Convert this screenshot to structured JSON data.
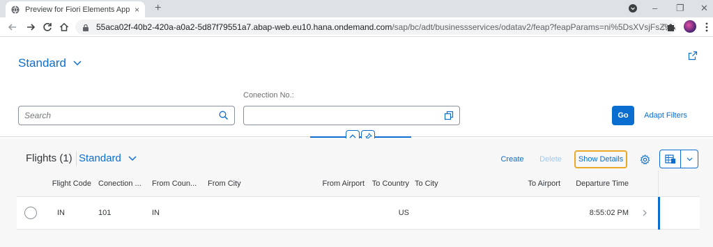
{
  "browser": {
    "tab_title": "Preview for Fiori Elements App",
    "tab_close": "×",
    "new_tab": "+",
    "url_host": "55aca02f-40b2-420a-a0a2-5d87f79551a7.abap-web.eu10.hana.ondemand.com",
    "url_path": "/sap/bc/adt/businessservices/odatav2/feap?feapParams=ni%5DsXVsjFsZ%...",
    "window_controls": {
      "minimize": "–",
      "restore": "❐",
      "close": "✕"
    }
  },
  "header": {
    "variant_label": "Standard",
    "filter_bar": {
      "search_placeholder": "Search",
      "connection_label": "Conection No.:",
      "connection_value": "",
      "go_label": "Go",
      "adapt_filters_label": "Adapt Filters"
    }
  },
  "table": {
    "title": "Flights (1)",
    "variant_label": "Standard",
    "toolbar": {
      "create_label": "Create",
      "delete_label": "Delete",
      "show_details_label": "Show Details"
    },
    "columns": [
      "Flight Code",
      "Conection ...",
      "From Coun...",
      "From City",
      "From Airport",
      "To Country",
      "To City",
      "To Airport",
      "Departure Time"
    ],
    "rows": [
      {
        "flight_code": "IN",
        "connection": "101",
        "from_country": "IN",
        "from_city": "",
        "from_airport": "",
        "to_country": "US",
        "to_city": "",
        "to_airport": "",
        "departure_time": "8:55:02 PM"
      }
    ]
  },
  "colors": {
    "accent": "#0a6ed1",
    "highlight_border": "#e9a825",
    "table_background": "#f7f7f7"
  },
  "icons": {
    "favicon": "globe-icon",
    "lock": "lock-icon",
    "star": "star-icon",
    "extensions": "puzzle-icon",
    "share": "share-icon",
    "search": "search-icon",
    "value_help": "value-help-icon",
    "collapse": "chevron-up-icon",
    "pin": "pin-icon",
    "settings": "gear-icon",
    "export": "spreadsheet-export-icon",
    "export_menu": "chevron-down-icon",
    "row_nav": "chevron-right-icon"
  }
}
